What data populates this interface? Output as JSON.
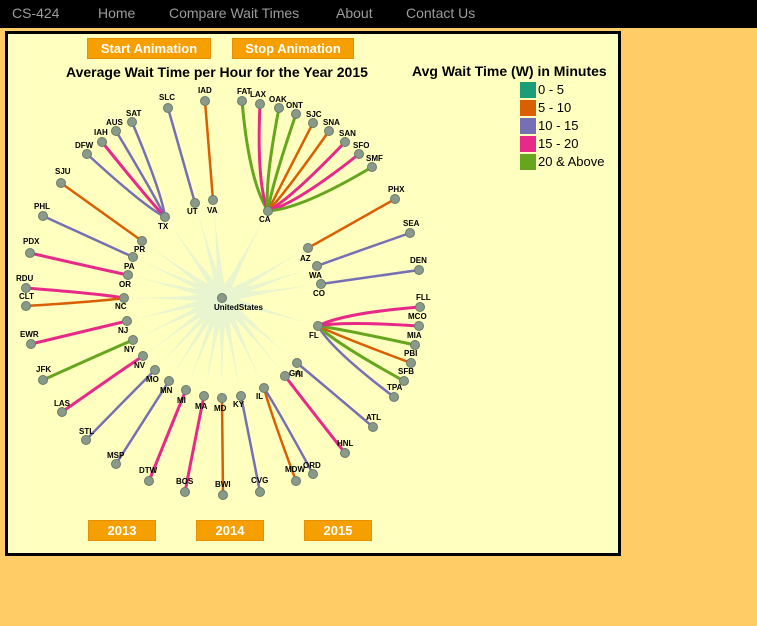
{
  "navbar": {
    "brand": "CS-424",
    "links": [
      "Home",
      "Compare Wait Times",
      "About",
      "Contact Us"
    ]
  },
  "controls": {
    "start_label": "Start Animation",
    "stop_label": "Stop Animation",
    "years": [
      "2013",
      "2014",
      "2015"
    ]
  },
  "chart_data": {
    "type": "radial-edge-bundle",
    "title": "Average Wait Time per Hour for the Year 2015",
    "center": "UnitedStates",
    "legend": {
      "title": "Avg Wait Time (W) in Minutes",
      "items": [
        {
          "label": "0 - 5",
          "color": "#1b9e77"
        },
        {
          "label": "5 - 10",
          "color": "#d95f02"
        },
        {
          "label": "10 - 15",
          "color": "#7570b3"
        },
        {
          "label": "15 - 20",
          "color": "#e7298a"
        },
        {
          "label": "20 & Above",
          "color": "#66a61e"
        }
      ]
    },
    "states": [
      "TX",
      "UT",
      "VA",
      "CA",
      "PR",
      "PA",
      "OR",
      "NC",
      "NJ",
      "NY",
      "NV",
      "MO",
      "MN",
      "MI",
      "MA",
      "MD",
      "KY",
      "IL",
      "HI",
      "GA",
      "FL",
      "CO",
      "WA",
      "AZ"
    ],
    "airports": [
      {
        "code": "SAT",
        "state": "TX",
        "band": "10 - 15"
      },
      {
        "code": "AUS",
        "state": "TX",
        "band": "10 - 15"
      },
      {
        "code": "IAH",
        "state": "TX",
        "band": "15 - 20"
      },
      {
        "code": "DFW",
        "state": "TX",
        "band": "10 - 15"
      },
      {
        "code": "SLC",
        "state": "UT",
        "band": "10 - 15"
      },
      {
        "code": "IAD",
        "state": "VA",
        "band": "5 - 10"
      },
      {
        "code": "FAT",
        "state": "CA",
        "band": "20 & Above"
      },
      {
        "code": "LAX",
        "state": "CA",
        "band": "15 - 20"
      },
      {
        "code": "OAK",
        "state": "CA",
        "band": "20 & Above"
      },
      {
        "code": "ONT",
        "state": "CA",
        "band": "20 & Above"
      },
      {
        "code": "SJC",
        "state": "CA",
        "band": "5 - 10"
      },
      {
        "code": "SNA",
        "state": "CA",
        "band": "5 - 10"
      },
      {
        "code": "SAN",
        "state": "CA",
        "band": "15 - 20"
      },
      {
        "code": "SFO",
        "state": "CA",
        "band": "15 - 20"
      },
      {
        "code": "SMF",
        "state": "CA",
        "band": "20 & Above"
      },
      {
        "code": "SJU",
        "state": "PR",
        "band": "5 - 10"
      },
      {
        "code": "PHL",
        "state": "PA",
        "band": "10 - 15"
      },
      {
        "code": "PDX",
        "state": "OR",
        "band": "15 - 20"
      },
      {
        "code": "RDU",
        "state": "NC",
        "band": "15 - 20"
      },
      {
        "code": "CLT",
        "state": "NC",
        "band": "5 - 10"
      },
      {
        "code": "EWR",
        "state": "NJ",
        "band": "15 - 20"
      },
      {
        "code": "JFK",
        "state": "NY",
        "band": "20 & Above"
      },
      {
        "code": "LAS",
        "state": "NV",
        "band": "15 - 20"
      },
      {
        "code": "STL",
        "state": "MO",
        "band": "10 - 15"
      },
      {
        "code": "MSP",
        "state": "MN",
        "band": "10 - 15"
      },
      {
        "code": "DTW",
        "state": "MI",
        "band": "15 - 20"
      },
      {
        "code": "BOS",
        "state": "MA",
        "band": "15 - 20"
      },
      {
        "code": "BWI",
        "state": "MD",
        "band": "5 - 10"
      },
      {
        "code": "CVG",
        "state": "KY",
        "band": "10 - 15"
      },
      {
        "code": "MDW",
        "state": "IL",
        "band": "5 - 10"
      },
      {
        "code": "ORD",
        "state": "IL",
        "band": "10 - 15"
      },
      {
        "code": "HNL",
        "state": "HI",
        "band": "15 - 20"
      },
      {
        "code": "ATL",
        "state": "GA",
        "band": "10 - 15"
      },
      {
        "code": "TPA",
        "state": "FL",
        "band": "10 - 15"
      },
      {
        "code": "SFB",
        "state": "FL",
        "band": "20 & Above"
      },
      {
        "code": "PBI",
        "state": "FL",
        "band": "5 - 10"
      },
      {
        "code": "MIA",
        "state": "FL",
        "band": "20 & Above"
      },
      {
        "code": "MCO",
        "state": "FL",
        "band": "15 - 20"
      },
      {
        "code": "FLL",
        "state": "FL",
        "band": "15 - 20"
      },
      {
        "code": "DEN",
        "state": "CO",
        "band": "10 - 15"
      },
      {
        "code": "SEA",
        "state": "WA",
        "band": "10 - 15"
      },
      {
        "code": "PHX",
        "state": "AZ",
        "band": "5 - 10"
      }
    ]
  }
}
